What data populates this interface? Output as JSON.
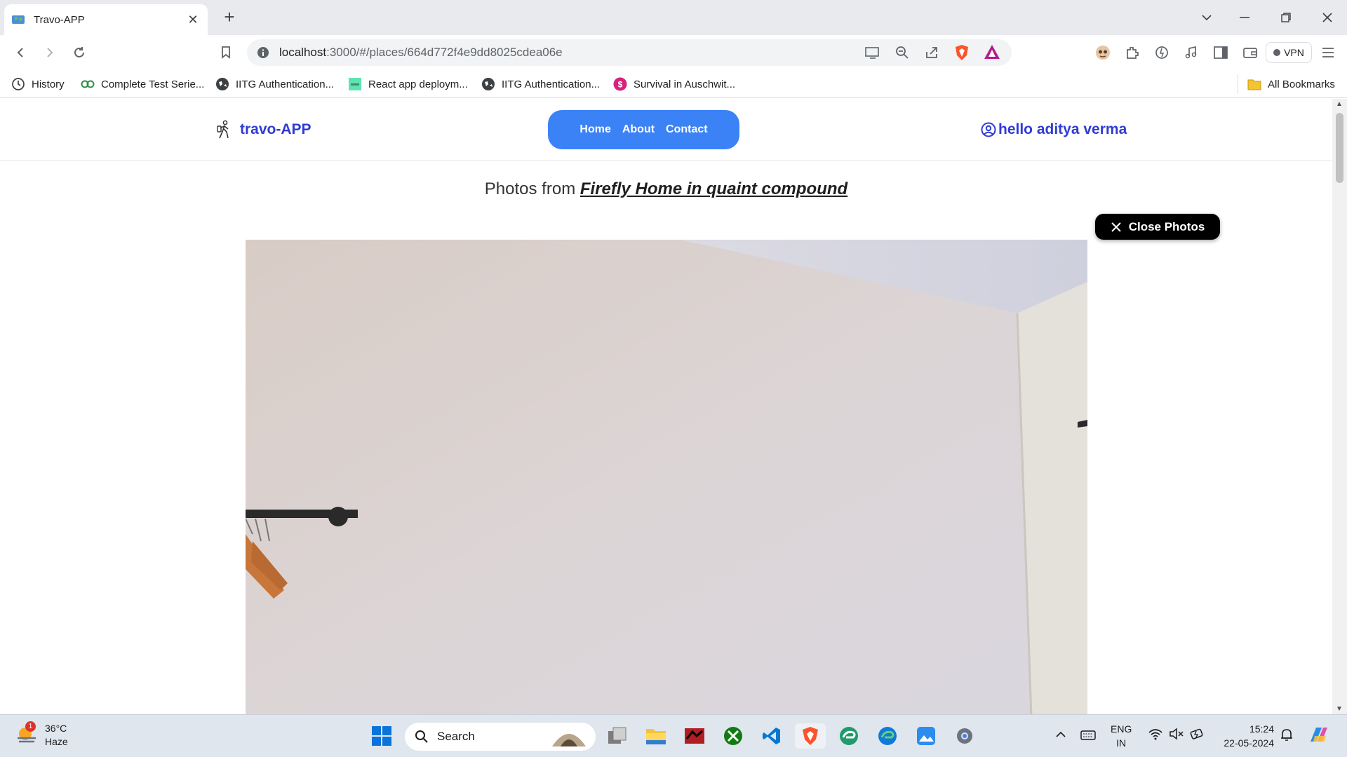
{
  "browser": {
    "tab_title": "Travo-APP",
    "url_host": "localhost",
    "url_rest": ":3000/#/places/664d772f4e9dd8025cdea06e",
    "vpn_label": "VPN",
    "bookmarks": [
      {
        "label": "History",
        "icon": "history-icon"
      },
      {
        "label": "Complete Test Serie...",
        "icon": "gfg-icon"
      },
      {
        "label": "IITG Authentication...",
        "icon": "globe-icon"
      },
      {
        "label": "React app deploym...",
        "icon": "image-icon"
      },
      {
        "label": "IITG Authentication...",
        "icon": "globe-icon"
      },
      {
        "label": "Survival in Auschwit...",
        "icon": "s-icon"
      }
    ],
    "all_bookmarks_label": "All Bookmarks"
  },
  "site": {
    "logo_text": "travo-APP",
    "nav": [
      "Home",
      "About",
      "Contact"
    ],
    "user_greeting": "hello aditya verma",
    "photos_prefix": "Photos from ",
    "place_name": "Firefly Home in quaint compound",
    "close_photos_label": "Close Photos"
  },
  "taskbar": {
    "temperature": "36°C",
    "weather_desc": "Haze",
    "weather_badge": "1",
    "search_placeholder": "Search",
    "lang_line1": "ENG",
    "lang_line2": "IN",
    "time": "15:24",
    "date": "22-05-2024"
  },
  "colors": {
    "brand": "#2f3bd6",
    "nav_pill": "#3b82f6",
    "close_button": "#000000"
  }
}
